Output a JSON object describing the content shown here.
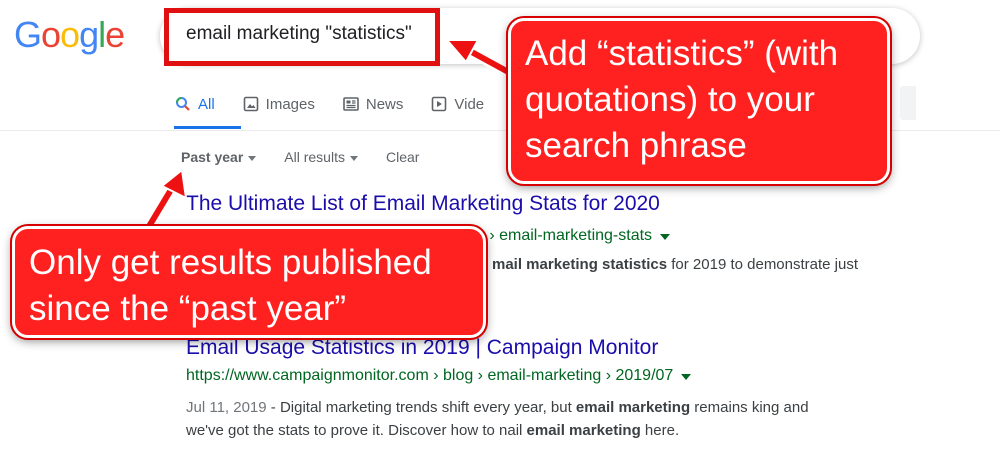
{
  "logo": {
    "letters": [
      "G",
      "o",
      "o",
      "g",
      "l",
      "e"
    ],
    "colors": [
      "#4285F4",
      "#EA4335",
      "#FBBC05",
      "#4285F4",
      "#34A853",
      "#EA4335"
    ]
  },
  "search": {
    "query": "email marketing \"statistics\""
  },
  "tabs": [
    {
      "label": "All",
      "icon": "search-icon",
      "active": true
    },
    {
      "label": "Images",
      "icon": "image-icon",
      "active": false
    },
    {
      "label": "News",
      "icon": "news-icon",
      "active": false
    },
    {
      "label": "Vide",
      "icon": "video-icon",
      "active": false
    }
  ],
  "tools": {
    "time": "Past year",
    "results": "All results",
    "clear": "Clear"
  },
  "results": [
    {
      "title": "The Ultimate List of Email Marketing Stats for 2020",
      "url": "g › email-marketing-stats",
      "snippet_pre": "",
      "snippet_bold": "mail marketing statistics",
      "snippet_post": " for 2019 to demonstrate just"
    },
    {
      "title": "Email Usage Statistics in 2019 | Campaign Monitor",
      "url": "https://www.campaignmonitor.com › blog › email-marketing › 2019/07",
      "date": "Jul 11, 2019",
      "line1_pre": " - Digital marketing trends shift every year, but ",
      "line1_bold": "email marketing",
      "line1_post": " remains king and",
      "line2_pre": "we've got the stats to prove it. Discover how to nail ",
      "line2_bold": "email marketing",
      "line2_post": " here."
    }
  ],
  "callouts": {
    "statistics": {
      "line1": "Add “statistics” (with",
      "line2": "quotations) to your",
      "line3": "search phrase"
    },
    "past_year": {
      "line1": "Only get results published",
      "line2": "since the “past year”"
    }
  },
  "colors": {
    "callout": "#ff2020",
    "link": "#1a0dab",
    "url": "#006621",
    "accent": "#1a73e8"
  }
}
